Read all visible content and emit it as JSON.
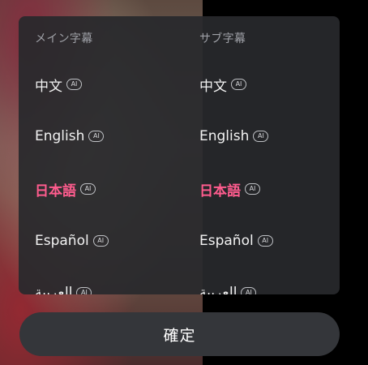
{
  "dialog": {
    "main_header": "メイン字幕",
    "sub_header": "サブ字幕",
    "ai_badge": "AI",
    "main_items": [
      {
        "label": "中文",
        "selected": false
      },
      {
        "label": "English",
        "selected": false
      },
      {
        "label": "日本語",
        "selected": true
      },
      {
        "label": "Español",
        "selected": false
      },
      {
        "label": "العربية",
        "selected": false
      }
    ],
    "sub_items": [
      {
        "label": "中文",
        "selected": false
      },
      {
        "label": "English",
        "selected": false
      },
      {
        "label": "日本語",
        "selected": true
      },
      {
        "label": "Español",
        "selected": false
      },
      {
        "label": "العربية",
        "selected": false
      }
    ],
    "confirm_label": "確定",
    "accent_color": "#ff5c8e"
  }
}
